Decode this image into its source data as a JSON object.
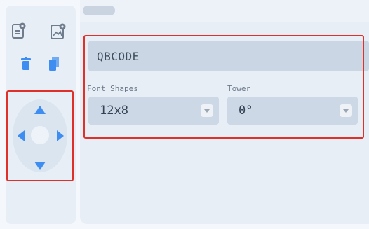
{
  "sidebar": {
    "icons": [
      {
        "name": "document-settings-icon"
      },
      {
        "name": "image-settings-icon"
      },
      {
        "name": "trash-icon"
      },
      {
        "name": "copy-icon"
      }
    ]
  },
  "dpad": {
    "up": "arrow-up-icon",
    "down": "arrow-down-icon",
    "left": "arrow-left-icon",
    "right": "arrow-right-icon"
  },
  "element": {
    "name_value": "QBCODE",
    "font_shapes_label": "Font Shapes",
    "font_shapes_value": "12x8",
    "tower_label": "Tower",
    "tower_value": "0°"
  },
  "colors": {
    "accent": "#3d8ef0",
    "highlight": "#e0302a",
    "panel": "#e7eef6"
  }
}
